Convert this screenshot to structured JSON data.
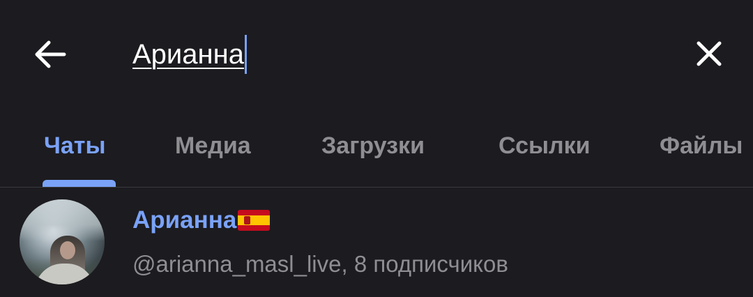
{
  "header": {
    "back_icon": "arrow-left-icon",
    "search_value": "Арианна",
    "clear_icon": "close-icon"
  },
  "tabs": [
    {
      "label": "Чаты",
      "active": true
    },
    {
      "label": "Медиа",
      "active": false
    },
    {
      "label": "Загрузки",
      "active": false
    },
    {
      "label": "Ссылки",
      "active": false
    },
    {
      "label": "Файлы",
      "active": false
    }
  ],
  "results": [
    {
      "name": "Арианна",
      "flag_icon": "spain-flag-icon",
      "subtitle": "@arianna_masl_live, 8 подписчиков"
    }
  ],
  "colors": {
    "background": "#1c1b1f",
    "accent": "#7aa2f7",
    "inactive_text": "#8e8e93",
    "primary_text": "#ffffff",
    "divider": "#3a3a3f"
  }
}
